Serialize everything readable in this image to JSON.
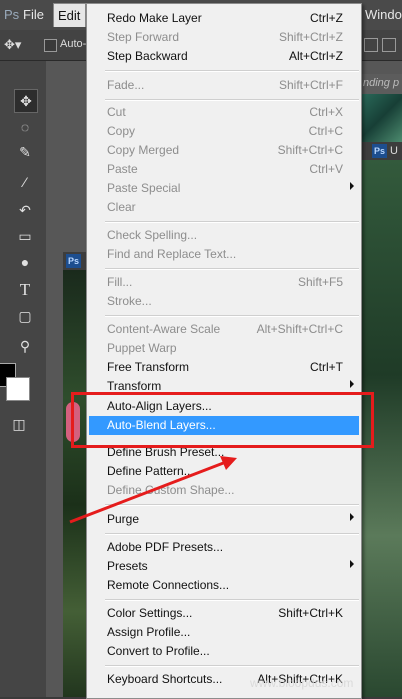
{
  "menubar": {
    "file": "File",
    "edit": "Edit",
    "window": "Windo"
  },
  "options_bar": {
    "auto_label": "Auto-"
  },
  "documents": {
    "badge": "Ps",
    "right_title_fragment": "nding p",
    "right_tab_fragment": "U"
  },
  "menu": {
    "items": [
      {
        "label": "Redo Make Layer",
        "shortcut": "Ctrl+Z"
      },
      {
        "label": "Step Forward",
        "shortcut": "Shift+Ctrl+Z"
      },
      {
        "label": "Step Backward",
        "shortcut": "Alt+Ctrl+Z"
      },
      {
        "label": "Fade...",
        "shortcut": "Shift+Ctrl+F"
      },
      {
        "label": "Cut",
        "shortcut": "Ctrl+X"
      },
      {
        "label": "Copy",
        "shortcut": "Ctrl+C"
      },
      {
        "label": "Copy Merged",
        "shortcut": "Shift+Ctrl+C"
      },
      {
        "label": "Paste",
        "shortcut": "Ctrl+V"
      },
      {
        "label": "Paste Special",
        "shortcut": ""
      },
      {
        "label": "Clear",
        "shortcut": ""
      },
      {
        "label": "Check Spelling...",
        "shortcut": ""
      },
      {
        "label": "Find and Replace Text...",
        "shortcut": ""
      },
      {
        "label": "Fill...",
        "shortcut": "Shift+F5"
      },
      {
        "label": "Stroke...",
        "shortcut": ""
      },
      {
        "label": "Content-Aware Scale",
        "shortcut": "Alt+Shift+Ctrl+C"
      },
      {
        "label": "Puppet Warp",
        "shortcut": ""
      },
      {
        "label": "Free Transform",
        "shortcut": "Ctrl+T"
      },
      {
        "label": "Transform",
        "shortcut": ""
      },
      {
        "label": "Auto-Align Layers...",
        "shortcut": ""
      },
      {
        "label": "Auto-Blend Layers...",
        "shortcut": ""
      },
      {
        "label": "Define Brush Preset...",
        "shortcut": ""
      },
      {
        "label": "Define Pattern...",
        "shortcut": ""
      },
      {
        "label": "Define Custom Shape...",
        "shortcut": ""
      },
      {
        "label": "Purge",
        "shortcut": ""
      },
      {
        "label": "Adobe PDF Presets...",
        "shortcut": ""
      },
      {
        "label": "Presets",
        "shortcut": ""
      },
      {
        "label": "Remote Connections...",
        "shortcut": ""
      },
      {
        "label": "Color Settings...",
        "shortcut": "Shift+Ctrl+K"
      },
      {
        "label": "Assign Profile...",
        "shortcut": ""
      },
      {
        "label": "Convert to Profile...",
        "shortcut": ""
      },
      {
        "label": "Keyboard Shortcuts...",
        "shortcut": "Alt+Shift+Ctrl+K"
      }
    ]
  },
  "watermark": "www.bloopdus.com",
  "colors": {
    "highlight": "#3399ff",
    "annotation": "#e51c1c"
  }
}
